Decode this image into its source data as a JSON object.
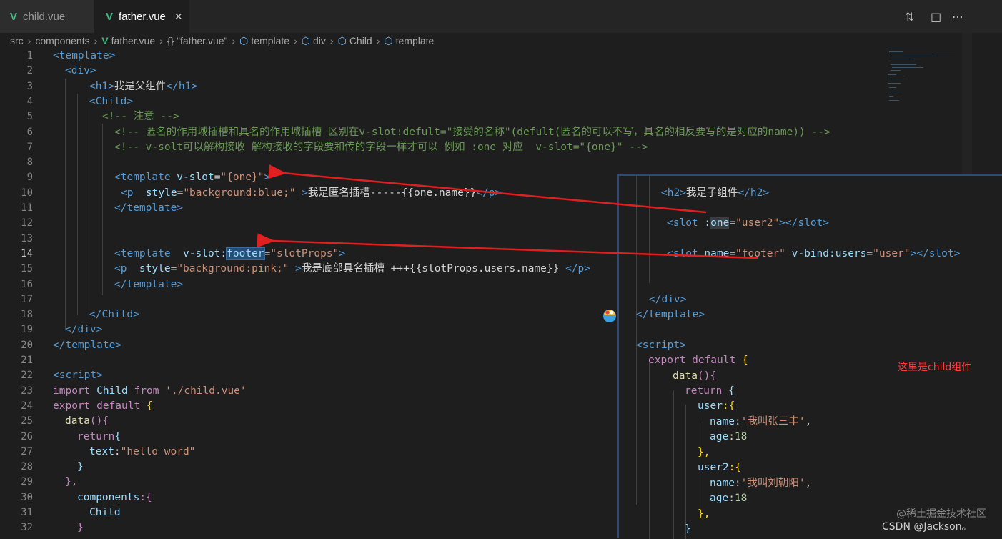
{
  "tabs": [
    {
      "label": "child.vue",
      "icon": "vue-icon",
      "active": false
    },
    {
      "label": "father.vue",
      "icon": "vue-icon",
      "active": true,
      "close": "✕"
    }
  ],
  "breadcrumb": [
    "src",
    "components",
    "father.vue",
    "{} \"father.vue\"",
    "template",
    "div",
    "Child",
    "template"
  ],
  "line_numbers": [
    "1",
    "2",
    "3",
    "4",
    "5",
    "6",
    "7",
    "8",
    "9",
    "10",
    "11",
    "12",
    "13",
    "14",
    "15",
    "16",
    "17",
    "18",
    "19",
    "20",
    "21",
    "22",
    "23",
    "24",
    "25",
    "26",
    "27",
    "28",
    "29",
    "30",
    "31",
    "32"
  ],
  "current_line": "14",
  "code": {
    "l1": "<template>",
    "l2": "<div>",
    "l3a": "<h1>",
    "l3b": "我是父组件",
    "l3c": "</h1>",
    "l4": "<Child>",
    "l5": "<!-- 注意 -->",
    "l6": "<!-- 匿名的作用域插槽和具名的作用域插槽 区别在v-slot:defult=\"接受的名称\"(defult(匿名的可以不写，具名的相反要写的是对应的name)) -->",
    "l7": "<!-- v-solt可以解构接收 解构接收的字段要和传的字段一样才可以 例如 :one 对应  v-slot=\"{one}\" -->",
    "l9a": "<template",
    "l9b": " v-slot",
    "l9c": "=",
    "l9d": "\"{one}\"",
    "l9e": ">",
    "l10a": "<p",
    "l10b": "  style",
    "l10c": "=",
    "l10d": "\"background:blue;\"",
    "l10e": " >",
    "l10f": "我是匿名插槽-----{{one.name}}",
    "l10g": "</p>",
    "l11": "</template>",
    "l14a": "<template",
    "l14b": "  v-slot:",
    "l14c": "footer",
    "l14d": "=",
    "l14e": "\"slotProps\"",
    "l14f": ">",
    "l15a": "<p",
    "l15b": "  style",
    "l15c": "=",
    "l15d": "\"background:pink;\"",
    "l15e": " >",
    "l15f": "我是底部具名插槽 +++{{slotProps.users.name}} ",
    "l15g": "</p>",
    "l16": "</template>",
    "l18": "</Child>",
    "l19": "</div>",
    "l20": "</template>",
    "l22": "<script>",
    "l23a": "import",
    "l23b": " Child ",
    "l23c": "from",
    "l23d": " './child.vue'",
    "l24a": "export default",
    "l24b": " {",
    "l25a": "data",
    "l25b": "(){",
    "l26a": "return",
    "l26b": "{",
    "l27a": "text",
    "l27b": ":",
    "l27c": "\"hello word\"",
    "l28": "}",
    "l29": "},",
    "l30a": "components",
    "l30b": ":{",
    "l31": "Child",
    "l32": "}"
  },
  "child_panel": {
    "p1a": "<h2>",
    "p1b": "我是子组件",
    "p1c": "</h2>",
    "p2a": "<slot",
    "p2b": " :",
    "p2c": "one",
    "p2d": "=",
    "p2e": "\"user2\"",
    "p2f": "></slot>",
    "p3a": "<slot",
    "p3b": " name",
    "p3c": "=",
    "p3d": "\"footer\"",
    "p3e": " v-bind:users",
    "p3f": "=",
    "p3g": "\"user\"",
    "p3h": "></slot>",
    "p4": "</div>",
    "p5": "</template>",
    "p6": "<script>",
    "p7a": "export default",
    "p7b": " {",
    "p8a": "data",
    "p8b": "(){",
    "p9a": "return",
    "p9b": " {",
    "p10a": "user",
    "p10b": ":{",
    "p11a": "name",
    "p11b": ":",
    "p11c": "'我叫张三丰'",
    "p11d": ",",
    "p12a": "age",
    "p12b": ":",
    "p12c": "18",
    "p13": "},",
    "p14a": "user2",
    "p14b": ":{",
    "p15a": "name",
    "p15b": ":",
    "p15c": "'我叫刘朝阳'",
    "p15d": ",",
    "p16a": "age",
    "p16b": ":",
    "p16c": "18",
    "p17": "},",
    "p18": "}"
  },
  "annotation": "这里是child组件",
  "watermarks": {
    "juejin": "@稀土掘金技术社区",
    "csdn": "CSDN @Jackson。"
  },
  "colors": {
    "accent_arrow": "#e02020",
    "vue": "#41b883",
    "tag": "#569cd6",
    "string": "#ce9178",
    "comment": "#6a9955"
  }
}
